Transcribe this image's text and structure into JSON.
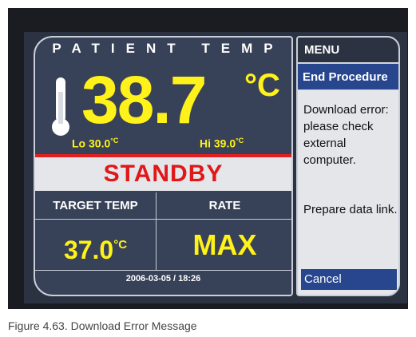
{
  "left": {
    "title": "PATIENT TEMP",
    "temp_value": "38.7",
    "temp_unit": "°C",
    "lo_label": "Lo",
    "lo_value": "30.0",
    "hi_label": "Hi",
    "hi_value": "39.0",
    "unit_small": "°C",
    "status": "STANDBY",
    "target_label": "TARGET TEMP",
    "target_value": "37.0",
    "target_unit": "°C",
    "rate_label": "RATE",
    "rate_value": "MAX",
    "datetime": "2006-03-05 / 18:26"
  },
  "menu": {
    "header": "MENU",
    "end_procedure": "End Procedure",
    "message": "Download error: please check external computer.",
    "message2": "Prepare data link.",
    "cancel": "Cancel"
  },
  "caption": "Figure 4.63. Download Error Message",
  "colors": {
    "screen_bg": "#2b3342",
    "panel_bg": "#374157",
    "value_yellow": "#fff21a",
    "status_red": "#e01818",
    "menu_blue": "#27468d"
  },
  "icons": {
    "thermometer": "thermometer-icon"
  }
}
